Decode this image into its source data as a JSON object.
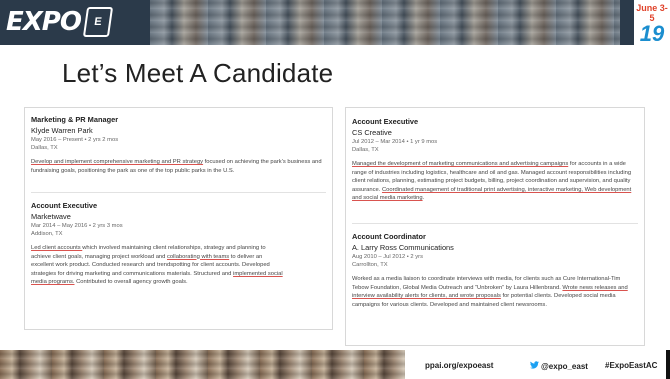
{
  "banner": {
    "logo_text": "EXPO",
    "logo_badge": "E",
    "date_top": "June 3-5",
    "date_year": "19"
  },
  "title": "Let’s Meet A Candidate",
  "left_card": {
    "entries": [
      {
        "job_title": "Marketing & PR Manager",
        "company": "Klyde Warren Park",
        "dates": "May 2016 – Present  •  2 yrs 2 mos",
        "location": "Dallas, TX",
        "desc_parts": [
          "Develop and implement comprehensive marketing and PR strategy",
          " focused on achieving the park’s business and fundraising goals, positioning the park as one of the top public parks in the U.S."
        ]
      },
      {
        "job_title": "Account Executive",
        "company": "Marketwave",
        "dates": "Mar 2014 – May 2016  •  2 yrs 3 mos",
        "location": "Addison, TX",
        "desc_parts": [
          "Led client accounts ",
          "which involved maintaining client relationships, strategy and planning to achieve client goals, managing project workload and ",
          "collaborating with teams",
          " to deliver an excellent work product. Conducted research and trendspotting for client accounts. Developed strategies for driving marketing and communications materials. Structured and ",
          "implemented social media programs.",
          " Contributed to overall agency growth goals."
        ]
      }
    ]
  },
  "right_card": {
    "entries": [
      {
        "job_title": "Account Executive",
        "company": "CS Creative",
        "dates": "Jul 2012 – Mar 2014  •  1 yr 9 mos",
        "location": "Dallas, TX",
        "desc_parts": [
          "Managed the development of marketing communications and advertising campaigns",
          " for accounts in a wide range of industries including logistics, healthcare and oil and gas. Managed account responsibilities including client relations, planning, estimating project budgets, billing, project coordination and supervision, and quality assurance. ",
          "Coordinated management of traditional print advertising, interactive marketing, Web development and social media marketing",
          "."
        ]
      },
      {
        "job_title": "Account Coordinator",
        "company": "A. Larry Ross Communications",
        "dates": "Aug 2010 – Jul 2012  •  2 yrs",
        "location": "Carrollton, TX",
        "desc_parts": [
          "Worked as a media liaison to coordinate interviews with media, for clients such as Cure International-Tim Tebow Foundation, Global Media Outreach and “Unbroken” by Laura Hillenbrand. ",
          "Wrote news releases and interview availability alerts for clients, and wrote proposals",
          " for potential clients. Developed social media campaigns for various clients. Developed and maintained client newsrooms."
        ]
      }
    ]
  },
  "footer": {
    "url": "ppai.org/expoeast",
    "twitter": "@expo_east",
    "hashtag": "#ExpoEastAC"
  },
  "colors": {
    "underline": "#d9534f",
    "twitter": "#1da1f2",
    "date_red": "#e0432b",
    "date_blue": "#1b8ecf"
  }
}
